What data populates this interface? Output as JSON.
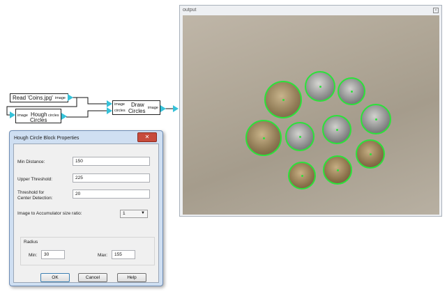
{
  "diagram": {
    "read_block": {
      "label": "Read 'Coins.jpg'",
      "port_out": "image"
    },
    "hough_block": {
      "port_in": "image",
      "title_line1": "Hough",
      "title_line2": "Circles",
      "port_out": "circles"
    },
    "draw_block": {
      "port_in_image": "image",
      "port_in_circles": "circles",
      "title_line1": "Draw",
      "title_line2": "Circles",
      "port_out": "image"
    }
  },
  "output_window": {
    "title": "output",
    "close_glyph": "×"
  },
  "dialog": {
    "title": "Hough Circle Block Properties",
    "close_glyph": "✕",
    "fields": {
      "min_distance": {
        "label": "Min Distance:",
        "value": "150"
      },
      "upper_threshold": {
        "label": "Upper Threshold:",
        "value": "225"
      },
      "center_threshold": {
        "label_line1": "Threshold for",
        "label_line2": "Center Detection:",
        "value": "20"
      },
      "accumulator_ratio": {
        "label": "Image to Accumulator size ratio:",
        "value": "1"
      }
    },
    "radius_group": {
      "title": "Radius",
      "min": {
        "label": "Min:",
        "value": "30"
      },
      "max": {
        "label": "Max:",
        "value": "155"
      }
    },
    "buttons": {
      "ok": "OK",
      "cancel": "Cancel",
      "help": "Help"
    }
  },
  "colors": {
    "port": "#36c2d9",
    "detection": "#2be33a",
    "dialog_close": "#c74b3c"
  }
}
